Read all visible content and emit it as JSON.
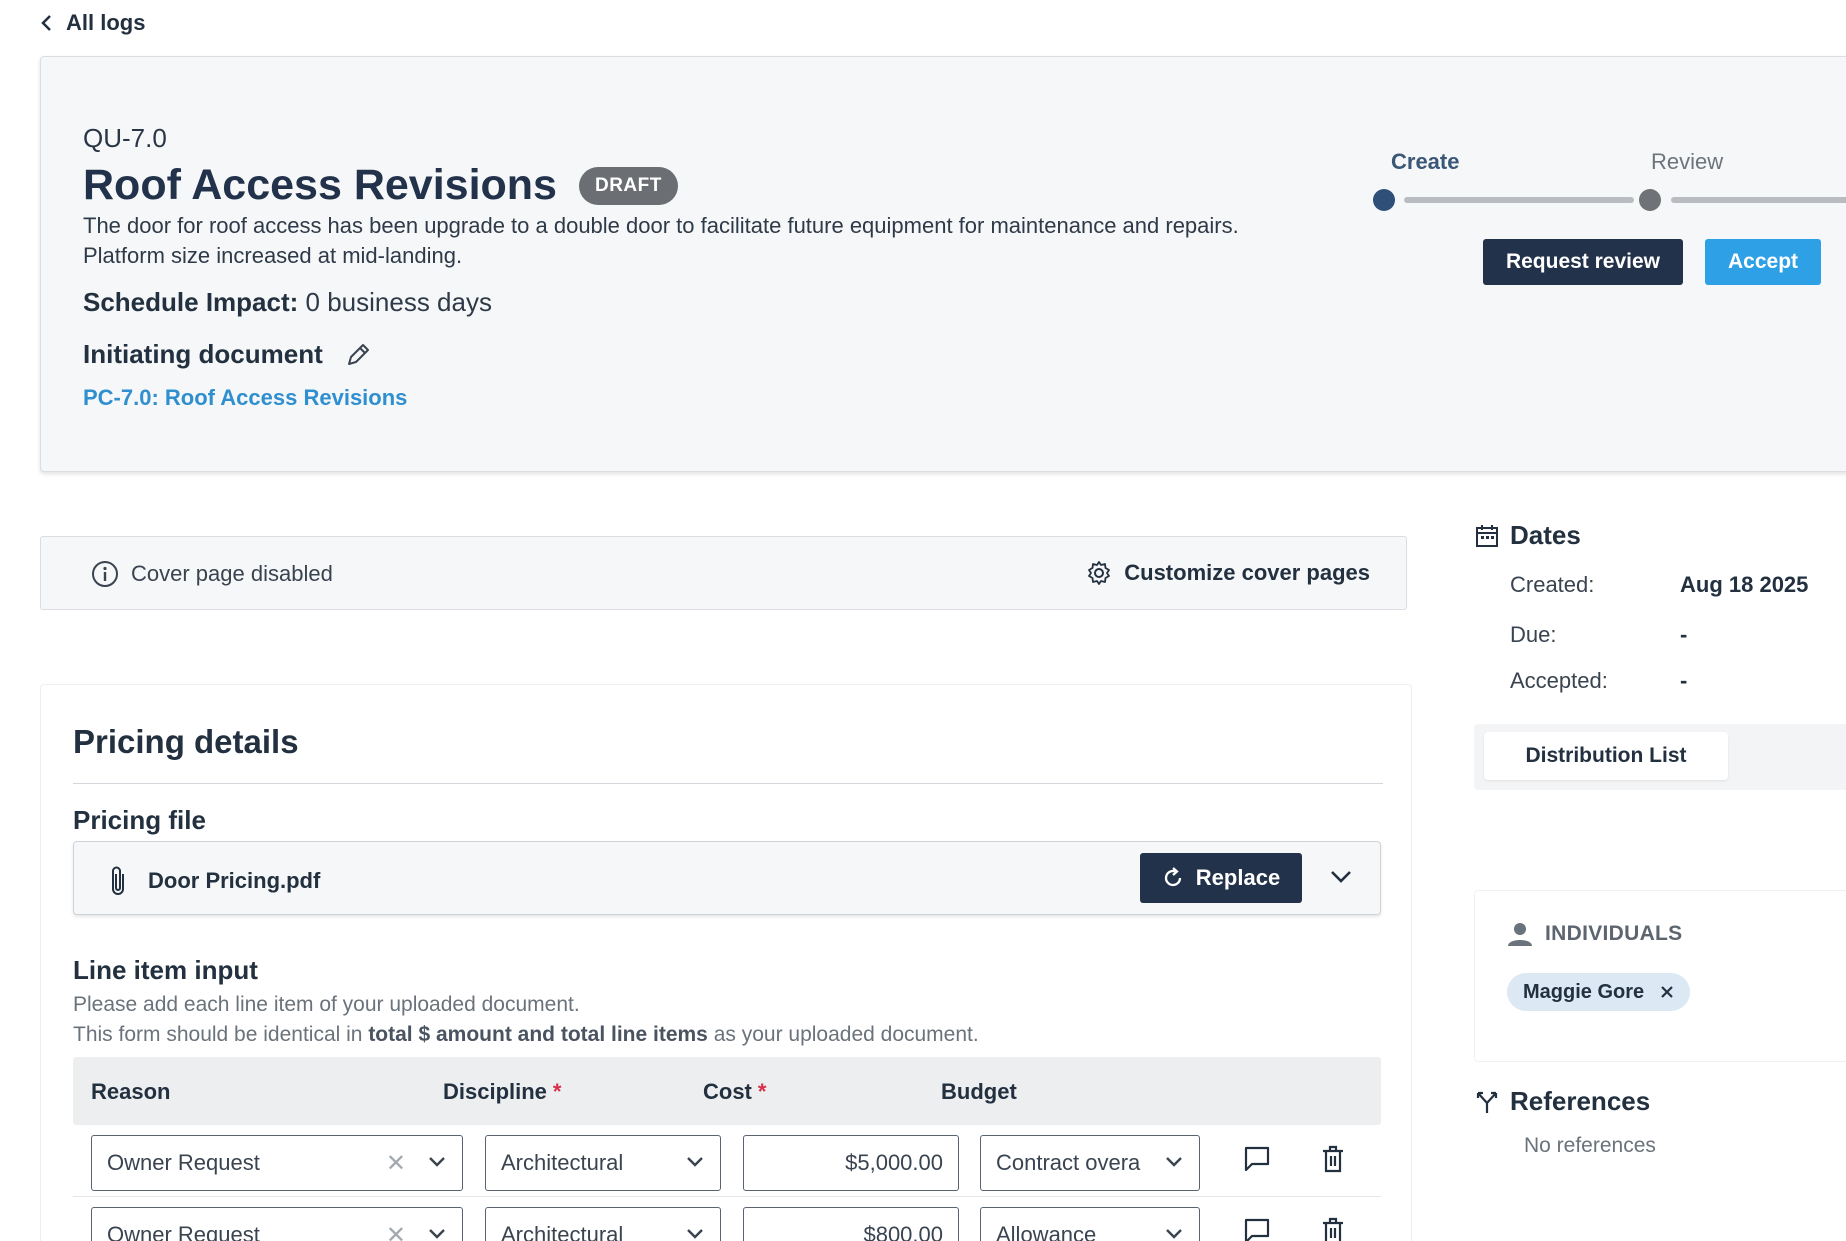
{
  "nav": {
    "back_label": "All logs"
  },
  "header": {
    "doc_id": "QU-7.0",
    "title": "Roof Access Revisions",
    "status_badge": "DRAFT",
    "description": "The door for roof access has been upgrade to a double door to facilitate future equipment for maintenance and repairs. Platform size increased at mid-landing.",
    "schedule_label": "Schedule Impact:",
    "schedule_value": "0 business days",
    "initiating_label": "Initiating document",
    "initiating_link": "PC-7.0: Roof Access Revisions",
    "steps": [
      {
        "label": "Create",
        "active": true
      },
      {
        "label": "Review",
        "active": false
      }
    ],
    "request_review_label": "Request review",
    "accept_label": "Accept",
    "colors": {
      "primary_dark": "#22324a",
      "accept_blue": "#2ea0e6",
      "link_blue": "#2f8fcf",
      "badge_gray": "#6b6e72"
    }
  },
  "cover": {
    "status_text": "Cover page disabled",
    "customize_label": "Customize cover pages"
  },
  "pricing": {
    "title": "Pricing details",
    "file_label": "Pricing file",
    "file_name": "Door Pricing.pdf",
    "replace_label": "Replace",
    "line_item_title": "Line item input",
    "help_line1": "Please add each line item of your uploaded document.",
    "help_line2_pre": "This form should be identical in ",
    "help_line2_bold": "total $ amount and total line items",
    "help_line2_post": " as your uploaded document.",
    "columns": {
      "reason": "Reason",
      "discipline": "Discipline",
      "cost": "Cost",
      "budget": "Budget",
      "required_mark": "*"
    },
    "rows": [
      {
        "reason": "Owner Request",
        "discipline": "Architectural",
        "cost": "$5,000.00",
        "budget": "Contract overa"
      },
      {
        "reason": "Owner Request",
        "discipline": "Architectural",
        "cost": "$800.00",
        "budget": "Allowance"
      }
    ]
  },
  "sidebar": {
    "dates_title": "Dates",
    "dates": [
      {
        "label": "Created:",
        "value": "Aug 18 2025"
      },
      {
        "label": "Due:",
        "value": "-"
      },
      {
        "label": "Accepted:",
        "value": "-"
      }
    ],
    "distribution_tab": "Distribution List",
    "individuals_title": "INDIVIDUALS",
    "individuals": [
      {
        "name": "Maggie Gore"
      }
    ],
    "references_title": "References",
    "references_empty": "No references"
  }
}
